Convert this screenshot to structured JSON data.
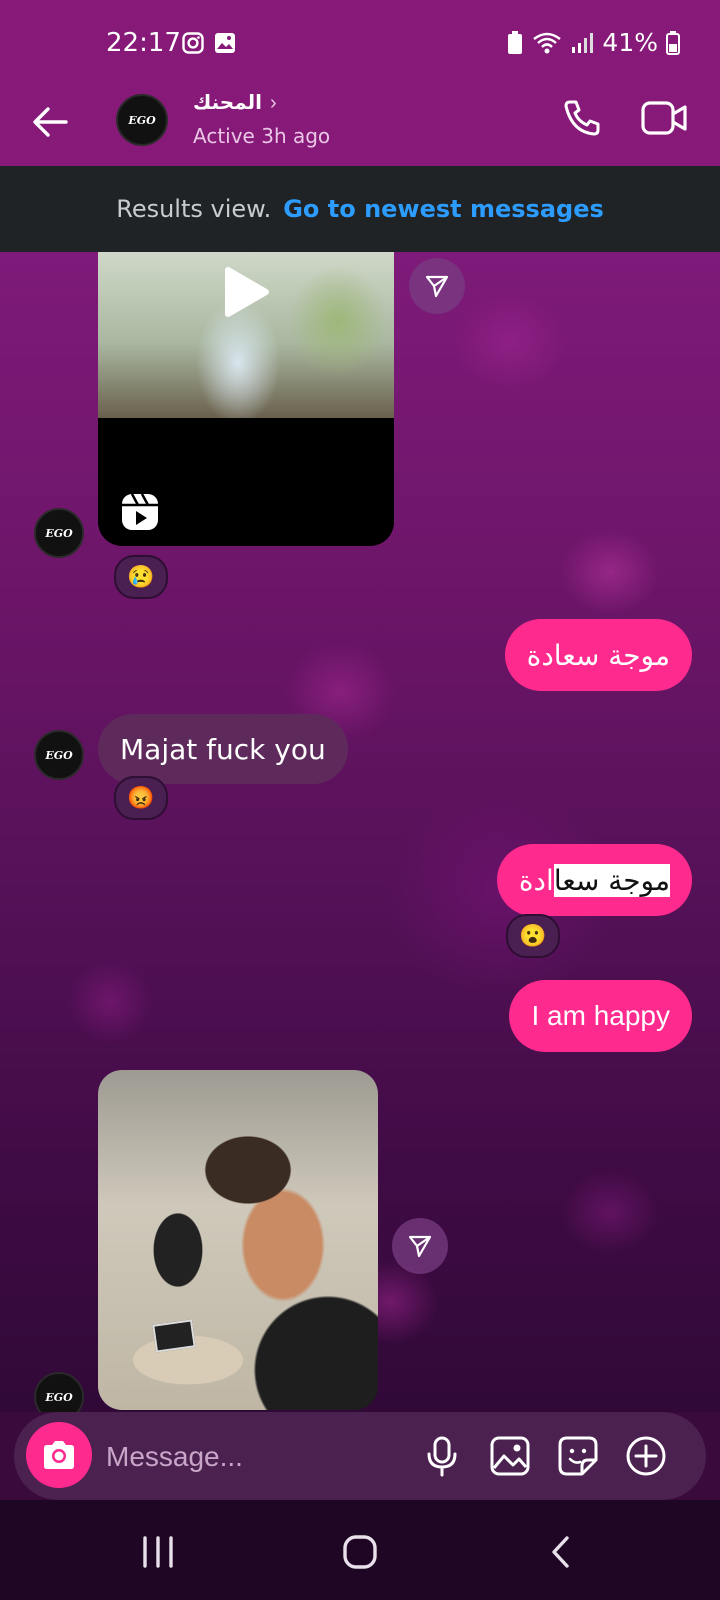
{
  "status": {
    "time": "22:17",
    "battery": "41%"
  },
  "header": {
    "contact_name": "المحنك",
    "active": "Active 3h ago",
    "avatar_text": "EGO"
  },
  "results": {
    "text": "Results view.",
    "link": "Go to newest messages"
  },
  "messages": [
    {
      "type": "reel",
      "from": "them",
      "reaction": "😢"
    },
    {
      "type": "text",
      "from": "me",
      "text": "موجة سعادة"
    },
    {
      "type": "text",
      "from": "them",
      "text": "Majat fuck you",
      "reaction": "😡"
    },
    {
      "type": "text",
      "from": "me",
      "text_plain": "ادة",
      "text_highlight": "موجة سعا",
      "reaction": "😮"
    },
    {
      "type": "text",
      "from": "me",
      "text": "I am happy"
    },
    {
      "type": "photo",
      "from": "them"
    }
  ],
  "composer": {
    "placeholder": "Message..."
  },
  "icons": [
    "back-arrow-icon",
    "chevron-right-icon",
    "phone-icon",
    "video-camera-icon",
    "play-icon",
    "reels-icon",
    "share-send-icon",
    "camera-icon",
    "microphone-icon",
    "gallery-icon",
    "sticker-icon",
    "plus-circle-icon",
    "recents-icon",
    "home-icon",
    "back-icon",
    "instagram-icon",
    "image-icon",
    "wifi-icon",
    "signal-icon",
    "battery-icon"
  ],
  "colors": {
    "header": "#871a78",
    "outgoing_bubble": "#ff2a8e",
    "incoming_bubble": "#5e2a5c",
    "link": "#2d9cff"
  }
}
